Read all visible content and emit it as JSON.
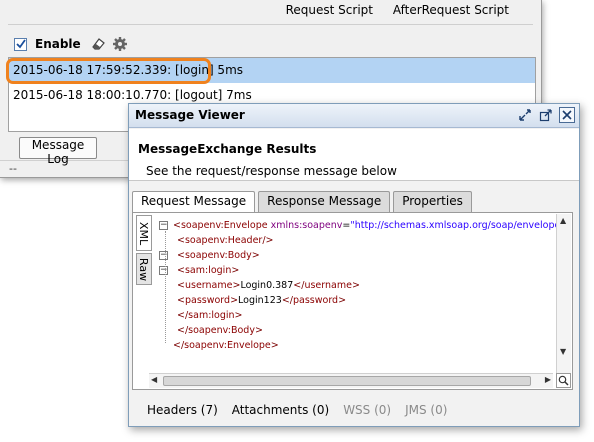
{
  "script_tabs": [
    "Request Script",
    "AfterRequest Script"
  ],
  "toolbar": {
    "enable_label": "Enable",
    "enable_checked": true
  },
  "log": {
    "entries": [
      "2015-06-18 17:59:52.339: [login] 5ms",
      "2015-06-18 18:00:10.770: [logout] 7ms"
    ],
    "selected_index": 0
  },
  "message_log_button": "Message Log",
  "status_text": "--",
  "viewer": {
    "title": "Message Viewer",
    "header_title": "MessageExchange Results",
    "header_subtitle": "See the request/response message below",
    "tabs": [
      "Request Message",
      "Response Message",
      "Properties"
    ],
    "active_tab": 0,
    "side_tabs": [
      "XML",
      "Raw"
    ],
    "xml_lines": [
      {
        "indent": 0,
        "open": "soapenv:Envelope",
        "attr": "xmlns:soapenv",
        "val": "\"http://schemas.xmlsoap.org/soap/envelope"
      },
      {
        "indent": 1,
        "self": "soapenv:Header"
      },
      {
        "indent": 1,
        "open": "soapenv:Body"
      },
      {
        "indent": 1,
        "open": "sam:login"
      },
      {
        "indent": 1,
        "elem": "username",
        "text": "Login0.387"
      },
      {
        "indent": 1,
        "elem": "password",
        "text": "Login123"
      },
      {
        "indent": 1,
        "close": "sam:login"
      },
      {
        "indent": 1,
        "close": "soapenv:Body"
      },
      {
        "indent": 0,
        "close": "soapenv:Envelope"
      }
    ],
    "bottom_tabs": [
      {
        "label": "Headers (7)",
        "enabled": true
      },
      {
        "label": "Attachments (0)",
        "enabled": true
      },
      {
        "label": "WSS (0)",
        "enabled": false
      },
      {
        "label": "JMS (0)",
        "enabled": false
      }
    ]
  },
  "colors": {
    "highlight_ring": "#f0821e",
    "selection": "#b3d3f3"
  }
}
